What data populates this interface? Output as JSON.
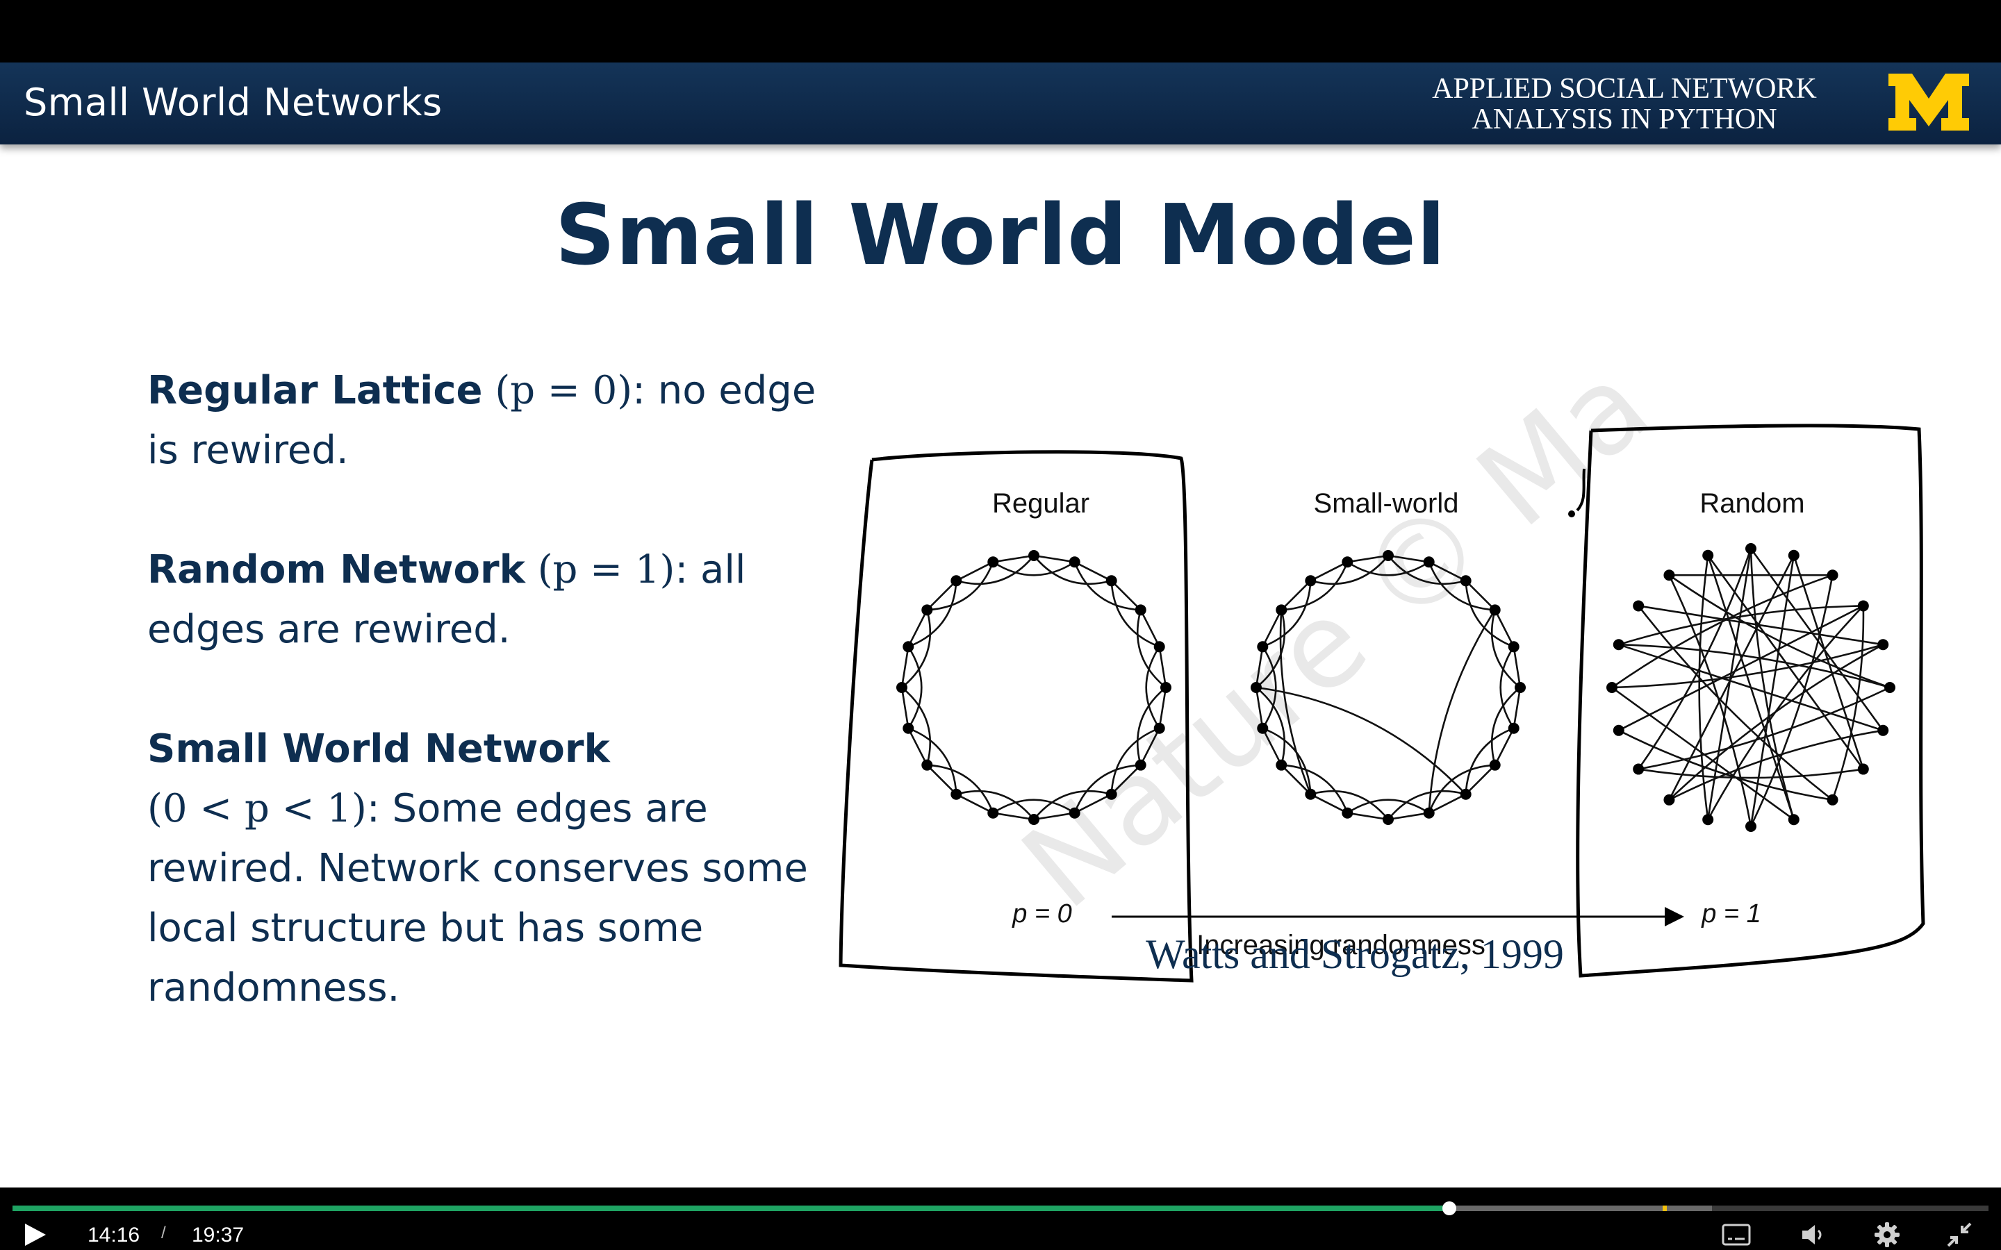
{
  "header": {
    "deck_title": "Small World Networks",
    "course_line1": "APPLIED SOCIAL NETWORK",
    "course_line2": "ANALYSIS IN PYTHON",
    "logo_color": "#ffcb05",
    "bar_color": "#0b2240"
  },
  "slide": {
    "title": "Small World Model",
    "text_color": "#0e2e50",
    "bullets": [
      {
        "term": "Regular Lattice",
        "param": "(p = 0)",
        "desc": ": no edge is rewired."
      },
      {
        "term": "Random Network",
        "param": "(p = 1)",
        "desc": ": all edges are rewired."
      },
      {
        "term": "Small World Network",
        "param": "(0 < p < 1)",
        "desc": ": Some edges are rewired. Network conserves some local structure but has some randomness."
      }
    ]
  },
  "figure": {
    "panels": [
      "Regular",
      "Small-world",
      "Random"
    ],
    "p_start": "p = 0",
    "p_end": "p = 1",
    "axis_label": "Increasing randomness",
    "watermark": "Nature © Ma",
    "citation": "Watts and Strogatz, 1999"
  },
  "player": {
    "current_time": "14:16",
    "separator": "/",
    "total_time": "19:37",
    "progress_fraction": 0.727,
    "buffered_fraction": 0.86,
    "marker_fraction": 0.835,
    "progress_color": "#1fa463",
    "icons": [
      "play-icon",
      "captions-icon",
      "volume-icon",
      "gear-icon",
      "exit-fullscreen-icon"
    ]
  }
}
